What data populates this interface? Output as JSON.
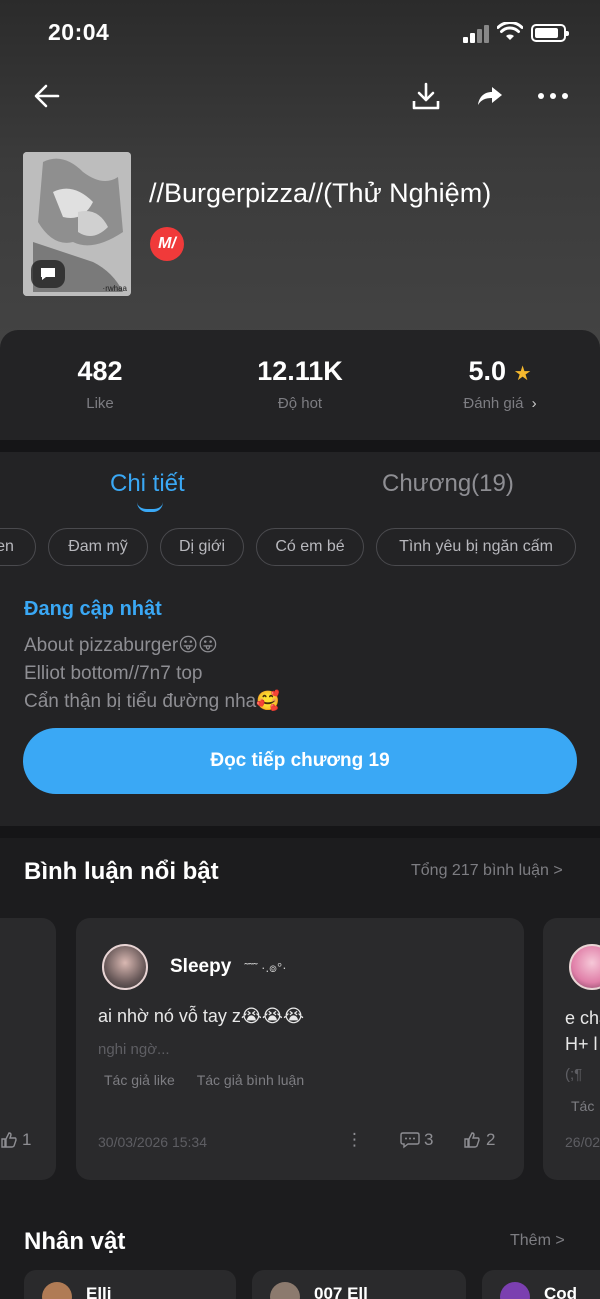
{
  "status_bar": {
    "time": "20:04"
  },
  "book": {
    "title": "//Burgerpizza//(Thử Nghiệm)",
    "platform_badge": "M/",
    "cover_watermark": "·rwhaa"
  },
  "stats": [
    {
      "value": "482",
      "label": "Like"
    },
    {
      "value": "12.11K",
      "label": "Độ hot"
    },
    {
      "value": "5.0",
      "label": "Đánh giá",
      "suffix": "›"
    }
  ],
  "tabs": [
    {
      "label": "Chi tiết",
      "active": true
    },
    {
      "label": "Chương(19)",
      "active": false
    }
  ],
  "tags": [
    "en",
    "Đam mỹ",
    "Dị giới",
    "Có em bé",
    "Tình yêu bị ngăn cấm"
  ],
  "detail": {
    "status": "Đang cập nhật",
    "description": [
      "About pizzaburger😛😛",
      "Elliot bottom//7n7 top",
      "Cẩn thận bị tiểu đường nha🥰"
    ],
    "read_button": "Đọc tiếp chương 19"
  },
  "comments": {
    "title": "Bình luận nổi bật",
    "total_link": "Tổng 217 bình luận >",
    "left_card": {
      "likes": "1"
    },
    "main": {
      "user": "Sleepy",
      "user_deco": "˜˜˜ ·.๏°·",
      "text": "ai nhờ nó vỗ tay z😭😭😭",
      "reply_preview": "nghi ngờ...",
      "badges": [
        "Tác giả like",
        "Tác giả bình luận"
      ],
      "date": "30/03/2026 15:34",
      "more": "⋮",
      "comment_count": "3",
      "like_count": "2"
    },
    "right_card": {
      "text_line1": "e cha",
      "text_line2": "H+ l",
      "reply_preview": "(;¶",
      "badge": "Tác",
      "date": "26/02"
    }
  },
  "characters": {
    "title": "Nhân vật",
    "more_link": "Thêm >",
    "items": [
      "Elli",
      "007 Ell",
      "Cod"
    ]
  },
  "colors": {
    "accent": "#3aa8f5",
    "star": "#f5b82e",
    "badge_red": "#f03a3a",
    "background": "#1c1c1e",
    "card": "#2a2a2c"
  },
  "icons": {
    "nav": [
      "back-arrow-icon",
      "download-icon",
      "share-icon",
      "more-dots-icon"
    ]
  }
}
